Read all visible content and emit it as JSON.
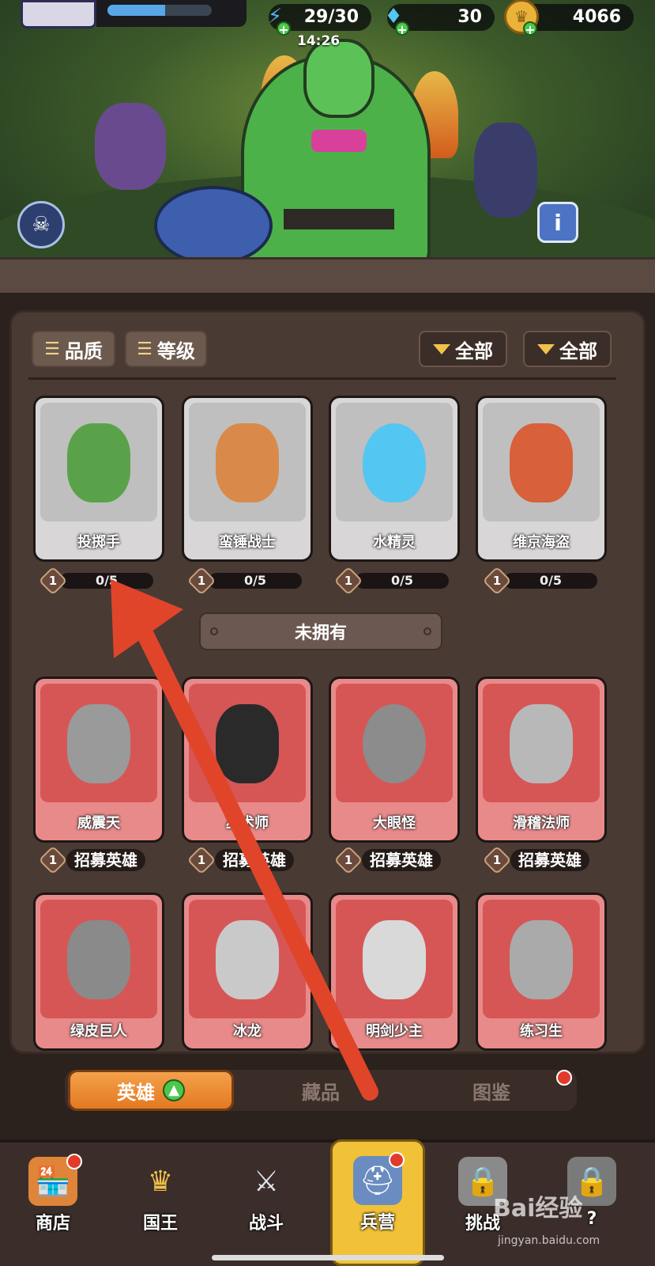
{
  "top_bar": {
    "xp_fill": 0.55,
    "energy": "29/30",
    "gems": "30",
    "coins": "4066",
    "timer": "14:26"
  },
  "filters": {
    "quality": "品质",
    "level": "等级",
    "filter1": "全部",
    "filter2": "全部"
  },
  "owned_heroes": [
    {
      "name": "投掷手",
      "level": "1",
      "progress": "0/5"
    },
    {
      "name": "蛮锤战士",
      "level": "1",
      "progress": "0/5"
    },
    {
      "name": "水精灵",
      "level": "1",
      "progress": "0/5"
    },
    {
      "name": "维京海盗",
      "level": "1",
      "progress": "0/5"
    }
  ],
  "section_label": "未拥有",
  "locked_heroes": [
    {
      "name": "威震天",
      "level": "1",
      "action": "招募英雄"
    },
    {
      "name": "巫术师",
      "level": "1",
      "action": "招募英雄"
    },
    {
      "name": "大眼怪",
      "level": "1",
      "action": "招募英雄"
    },
    {
      "name": "滑稽法师",
      "level": "1",
      "action": "招募英雄"
    },
    {
      "name": "绿皮巨人"
    },
    {
      "name": "冰龙"
    },
    {
      "name": "明剑少主"
    },
    {
      "name": "练习生"
    }
  ],
  "tabs": {
    "heroes": "英雄",
    "collection": "藏品",
    "codex": "图鉴"
  },
  "nav": {
    "shop": "商店",
    "king": "国王",
    "battle": "战斗",
    "barracks": "兵营",
    "challenge": "挑战",
    "locked": "?"
  },
  "watermark": {
    "main": "Bai经验",
    "sub": "jingyan.baidu.com"
  },
  "colors": {
    "accent_orange": "#e27a22",
    "locked_red": "#d65656",
    "badge_red": "#e23b2b",
    "arrow_red": "#e0452a"
  }
}
